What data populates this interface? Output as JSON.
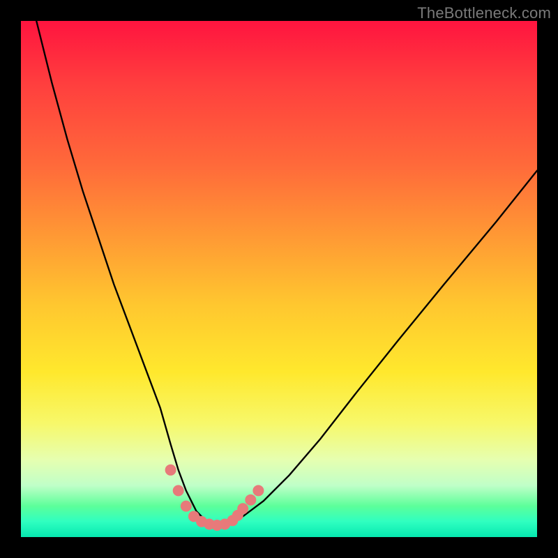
{
  "watermark": "TheBottleneck.com",
  "chart_data": {
    "type": "line",
    "title": "",
    "xlabel": "",
    "ylabel": "",
    "xlim": [
      0,
      100
    ],
    "ylim": [
      0,
      100
    ],
    "series": [
      {
        "name": "bottleneck-curve",
        "x": [
          3,
          6,
          9,
          12,
          15,
          18,
          21,
          24,
          27,
          29,
          30.5,
          32,
          34,
          36,
          38,
          40,
          43,
          47,
          52,
          58,
          65,
          73,
          82,
          92,
          100
        ],
        "values": [
          100,
          88,
          77,
          67,
          58,
          49,
          41,
          33,
          25,
          18,
          13,
          9,
          5,
          3,
          2,
          2.5,
          4,
          7,
          12,
          19,
          28,
          38,
          49,
          61,
          71
        ]
      }
    ],
    "markers": {
      "name": "highlight-dots",
      "color": "#e77a7a",
      "x": [
        29,
        30.5,
        32,
        33.5,
        35,
        36.5,
        38,
        39.5,
        41,
        42,
        43,
        44.5,
        46
      ],
      "values": [
        13,
        9,
        6,
        4,
        3,
        2.5,
        2.3,
        2.5,
        3.2,
        4.2,
        5.5,
        7.2,
        9
      ]
    },
    "gradient_stops": [
      {
        "pct": 0,
        "color": "#ff143f"
      },
      {
        "pct": 12,
        "color": "#ff3e3e"
      },
      {
        "pct": 28,
        "color": "#ff6a3a"
      },
      {
        "pct": 42,
        "color": "#ff9a34"
      },
      {
        "pct": 55,
        "color": "#ffc72f"
      },
      {
        "pct": 68,
        "color": "#ffe82d"
      },
      {
        "pct": 78,
        "color": "#f7f86a"
      },
      {
        "pct": 85,
        "color": "#e6ffb0"
      },
      {
        "pct": 90,
        "color": "#c0ffc8"
      },
      {
        "pct": 94,
        "color": "#5cff9a"
      },
      {
        "pct": 97,
        "color": "#2fffc0"
      },
      {
        "pct": 100,
        "color": "#06e8b0"
      }
    ]
  }
}
